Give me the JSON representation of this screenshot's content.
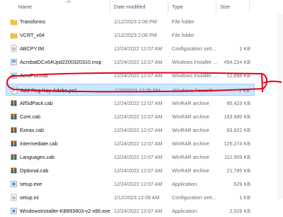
{
  "columns": {
    "name": "Name",
    "date": "Date modified",
    "type": "Type",
    "size": "Size"
  },
  "rows": [
    {
      "name": "Transforms",
      "date": "1/12/2023 2:06 PM",
      "type": "File folder",
      "size": "",
      "icon": "folder-icon"
    },
    {
      "name": "VCRT_x64",
      "date": "1/12/2023 2:06 PM",
      "type": "File folder",
      "size": "",
      "icon": "folder-icon"
    },
    {
      "name": "ABCPY.INI",
      "date": "12/24/2022 12:07 AM",
      "type": "Configuration sett...",
      "size": "1 KB",
      "icon": "config-file-icon"
    },
    {
      "name": "AcrobatDCx64Upd2200320310.msp",
      "date": "12/24/2022 12:07 AM",
      "type": "Windows Installer ...",
      "size": "494,224 KB",
      "icon": "installer-patch-icon"
    },
    {
      "name": "AcroPro.msi",
      "date": "12/24/2022 12:07 AM",
      "type": "Windows Installer ...",
      "size": "12,888 KB",
      "icon": "installer-package-icon"
    },
    {
      "name": "Add-Reg-Key-Adobe.ps1",
      "date": "1/20/2023 12:25 PM",
      "type": "Windows PowerS...",
      "size": "1 KB",
      "icon": "powershell-script-icon",
      "selected": true
    },
    {
      "name": "AlfSdPack.cab",
      "date": "12/24/2022 12:07 AM",
      "type": "WinRAR archive",
      "size": "85,423 KB",
      "icon": "winrar-archive-icon"
    },
    {
      "name": "Core.cab",
      "date": "12/24/2022 12:07 AM",
      "type": "WinRAR archive",
      "size": "183,980 KB",
      "icon": "winrar-archive-icon"
    },
    {
      "name": "Extras.cab",
      "date": "12/24/2022 12:07 AM",
      "type": "WinRAR archive",
      "size": "93,922 KB",
      "icon": "winrar-archive-icon"
    },
    {
      "name": "Intermediate.cab",
      "date": "12/24/2022 12:07 AM",
      "type": "WinRAR archive",
      "size": "125,274 KB",
      "icon": "winrar-archive-icon"
    },
    {
      "name": "Languages.cab",
      "date": "12/24/2022 12:07 AM",
      "type": "WinRAR archive",
      "size": "112,909 KB",
      "icon": "winrar-archive-icon"
    },
    {
      "name": "Optional.cab",
      "date": "12/24/2022 12:07 AM",
      "type": "WinRAR archive",
      "size": "21,785 KB",
      "icon": "winrar-archive-icon"
    },
    {
      "name": "setup.exe",
      "date": "12/24/2022 12:07 AM",
      "type": "Application",
      "size": "629 KB",
      "icon": "setup-exe-icon"
    },
    {
      "name": "setup.ini",
      "date": "1/12/2023 12:08 AM",
      "type": "Configuration sett...",
      "size": "1 KB",
      "icon": "config-file-icon"
    },
    {
      "name": "WindowsInstaller-KB893803-v2-x86.exe",
      "date": "12/24/2022 12:07 AM",
      "type": "Application",
      "size": "2,526 KB",
      "icon": "setup-exe-icon"
    }
  ],
  "colors": {
    "selection_bg": "#cce8ff",
    "selection_border": "#99d1ff",
    "annotation": "#e8001b",
    "folder": "#f5c242"
  }
}
